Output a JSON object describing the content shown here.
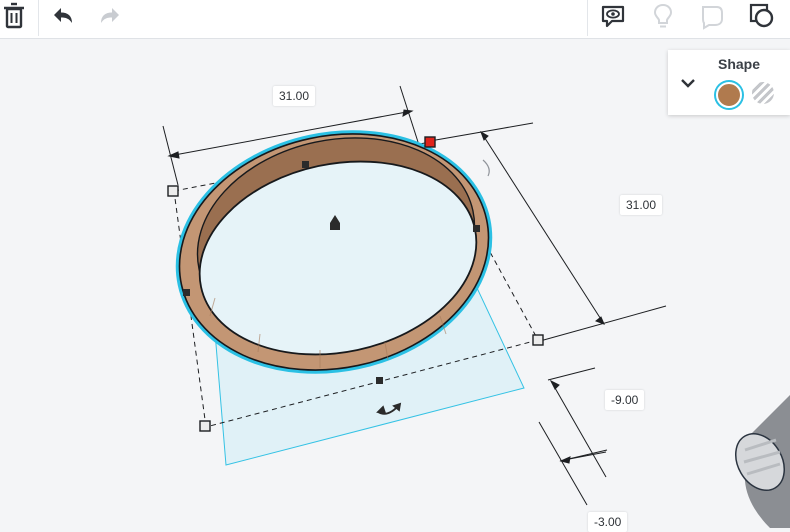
{
  "toolbar": {
    "left_icons": [
      "trash-icon",
      "undo-icon",
      "redo-icon"
    ],
    "right_icons": [
      "notes-eye-icon",
      "lightbulb-icon",
      "shape-speech-icon",
      "group-shape-icon"
    ]
  },
  "shape_panel": {
    "title": "Shape",
    "solid_color": "#b07a4e",
    "hole_pattern": "striped-gray"
  },
  "dimensions": {
    "width": "31.00",
    "length": "31.00",
    "height": "-9.00",
    "elevation": "-3.00"
  },
  "colors": {
    "selection": "#2bc0e4",
    "workplane_fill": "#dff1f8",
    "ring_outer": "#c39674",
    "ring_inner": "#8c6347",
    "handle_red": "#e0231b"
  }
}
